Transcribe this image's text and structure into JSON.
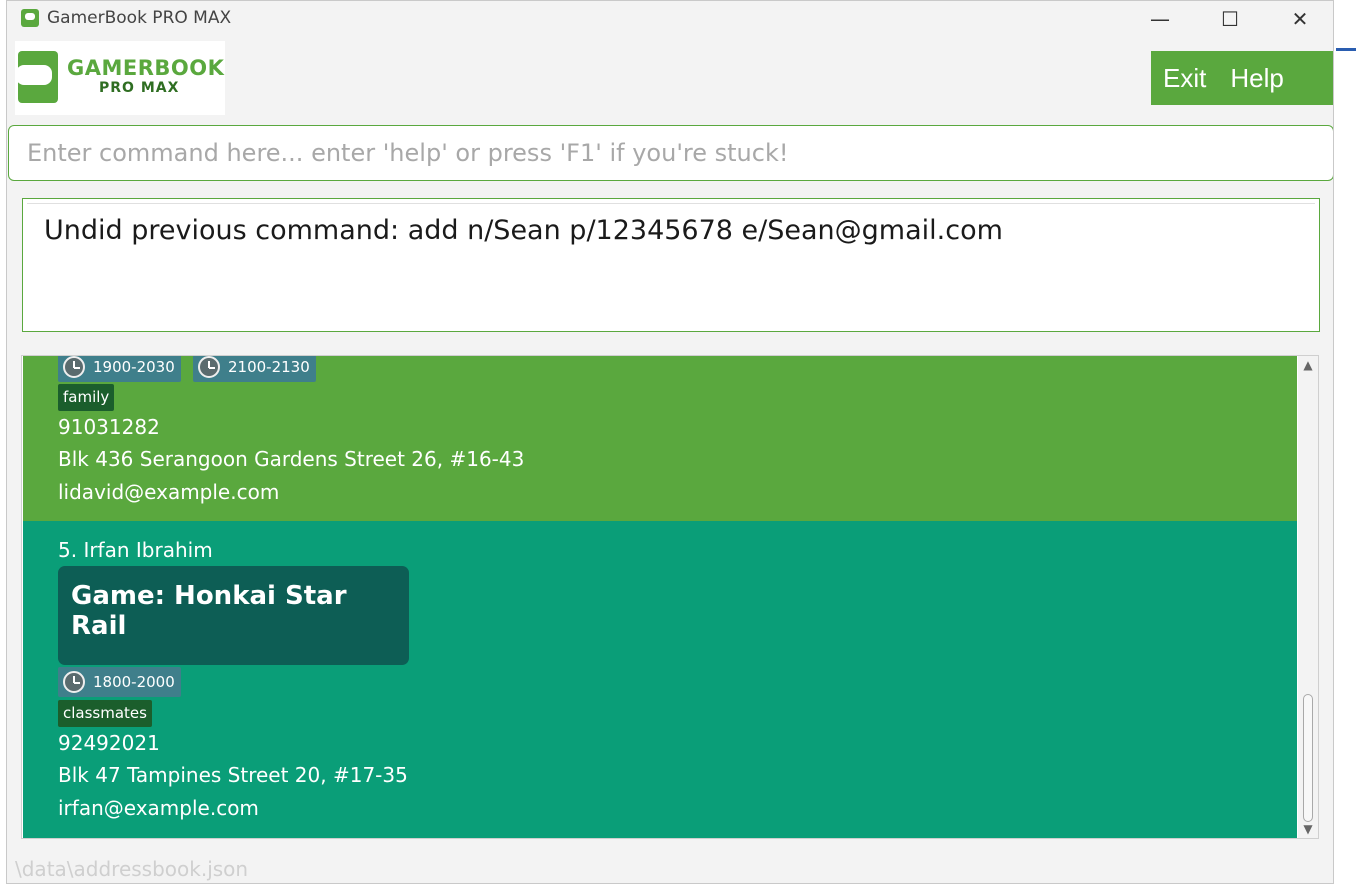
{
  "window": {
    "title": "GamerBook PRO MAX",
    "controls": {
      "minimize": "—",
      "maximize": "☐",
      "close": "✕"
    }
  },
  "logo": {
    "title": "GAMERBOOK",
    "subtitle": "PRO MAX"
  },
  "menu": {
    "exit_label": "Exit",
    "help_label": "Help"
  },
  "command": {
    "placeholder": "Enter command here... enter 'help' or press 'F1' if you're stuck!",
    "value": ""
  },
  "result": {
    "message": "Undid previous command: add n/Sean p/12345678 e/Sean@gmail.com"
  },
  "person_cards": [
    {
      "timeslots": [
        "1900-2030",
        "2100-2130"
      ],
      "tags": [
        "family"
      ],
      "phone": "91031282",
      "address": "Blk 436 Serangoon Gardens Street 26, #16-43",
      "email": "lidavid@example.com",
      "color": "#5aa83e"
    },
    {
      "index_name": "5. Irfan Ibrahim",
      "game": "Game: Honkai Star Rail",
      "timeslots": [
        "1800-2000"
      ],
      "tags": [
        "classmates"
      ],
      "phone": "92492021",
      "address": "Blk 47 Tampines Street 20, #17-35",
      "email": "irfan@example.com",
      "color": "#0a9e78"
    }
  ],
  "status": {
    "file_path": "\\data\\addressbook.json"
  },
  "colors": {
    "accent": "#5aa83e",
    "teal": "#0a9e78",
    "game_card": "#0d5e55",
    "tag": "#1b5e2c",
    "timeslot": "#3f7f8b"
  },
  "icons": {
    "app": "gamepad-book-icon",
    "clock": "clock-icon"
  }
}
